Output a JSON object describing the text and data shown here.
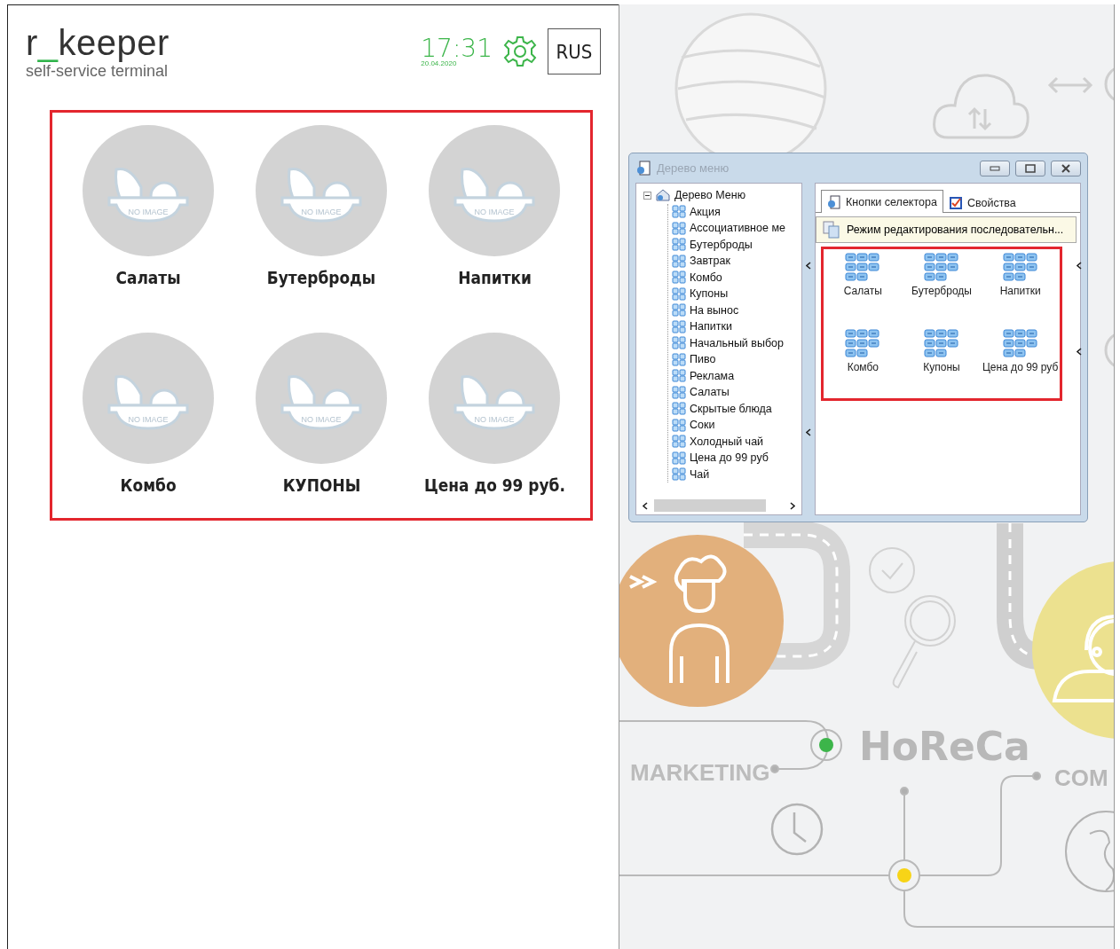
{
  "kiosk": {
    "logo": {
      "parts": [
        "r",
        "_",
        "keeper"
      ]
    },
    "subtitle": "self-service terminal",
    "time": "17:31",
    "date": "20.04.2020",
    "language_button": "RUS",
    "categories": [
      {
        "label": "Салаты",
        "image_text": "NO IMAGE"
      },
      {
        "label": "Бутерброды",
        "image_text": "NO IMAGE"
      },
      {
        "label": "Напитки",
        "image_text": "NO IMAGE"
      },
      {
        "label": "Комбо",
        "image_text": "NO IMAGE"
      },
      {
        "label": "КУПОНЫ",
        "image_text": "NO IMAGE"
      },
      {
        "label": "Цена до 99 руб.",
        "image_text": "NO IMAGE"
      }
    ]
  },
  "background": {
    "labels": [
      "MARKETING",
      "HoReCa",
      "COM"
    ]
  },
  "dialog": {
    "title": "Дерево меню",
    "tree": [
      {
        "label": "Дерево Меню",
        "expanded": true,
        "children": [
          {
            "label": "Акция"
          },
          {
            "label": "Ассоциативное ме"
          },
          {
            "label": "Бутерброды"
          },
          {
            "label": "Завтрак"
          },
          {
            "label": "Комбо"
          },
          {
            "label": "Купоны"
          },
          {
            "label": "На вынос"
          },
          {
            "label": "Напитки"
          },
          {
            "label": "Начальный выбор"
          },
          {
            "label": "Пиво"
          },
          {
            "label": "Реклама"
          },
          {
            "label": "Салаты"
          },
          {
            "label": "Скрытые блюда"
          },
          {
            "label": "Соки"
          },
          {
            "label": "Холодный чай"
          },
          {
            "label": "Цена до 99 руб"
          },
          {
            "label": "Чай"
          }
        ]
      }
    ],
    "tabs": [
      {
        "label": "Кнопки селектора",
        "selected": true
      },
      {
        "label": "Свойства",
        "selected": false
      }
    ],
    "mode_label": "Режим редактирования последовательн...",
    "selector_buttons": [
      {
        "label": "Салаты"
      },
      {
        "label": "Бутерброды"
      },
      {
        "label": "Напитки"
      },
      {
        "label": "Комбо"
      },
      {
        "label": "Купоны"
      },
      {
        "label": "Цена до 99 руб"
      }
    ]
  }
}
